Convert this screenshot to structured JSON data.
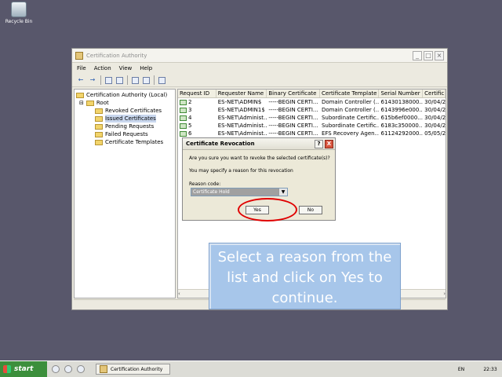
{
  "desktop": {
    "recycle_bin_label": "Recycle Bin"
  },
  "window": {
    "title": "Certification Authority",
    "menu": [
      "File",
      "Action",
      "View",
      "Help"
    ]
  },
  "tree": {
    "root_label": "Certification Authority (Local)",
    "child_label": "Root",
    "items": [
      "Revoked Certificates",
      "Issued Certificates",
      "Pending Requests",
      "Failed Requests",
      "Certificate Templates"
    ]
  },
  "list": {
    "columns": [
      "Request ID",
      "Requester Name",
      "Binary Certificate",
      "Certificate Template",
      "Serial Number",
      "Certific"
    ],
    "rows": [
      [
        "2",
        "ES-NET\\ADMIN$",
        "-----BEGIN CERTI...",
        "Domain Controller (...",
        "61430138000...",
        "30/04/2"
      ],
      [
        "3",
        "ES-NET\\ADMIN1$",
        "-----BEGIN CERTI...",
        "Domain Controller (...",
        "6143996e000...",
        "30/04/2"
      ],
      [
        "4",
        "ES-NET\\Administ...",
        "-----BEGIN CERTI...",
        "Subordinate Certific...",
        "615b6ef0000...",
        "30/04/2"
      ],
      [
        "5",
        "ES-NET\\Administ...",
        "-----BEGIN CERTI...",
        "Subordinate Certific...",
        "6183c350000...",
        "30/04/2"
      ],
      [
        "6",
        "ES-NET\\Administ...",
        "-----BEGIN CERTI...",
        "EFS Recovery Agen...",
        "61124292000...",
        "05/05/2"
      ]
    ]
  },
  "dialog": {
    "title": "Certificate Revocation",
    "question": "Are you sure you want to revoke the selected certificate(s)?",
    "subtext": "You may specify a reason for this revocation",
    "reason_label": "Reason code:",
    "reason_value": "Certificate Hold",
    "yes_label": "Yes",
    "no_label": "No",
    "help_label": "?",
    "close_label": "X"
  },
  "tooltip": {
    "text": "Select a reason from the list and click on Yes to continue."
  },
  "taskbar": {
    "start_label": "start",
    "task_label": "Certification Authority",
    "lang": "EN",
    "clock": "22:33"
  },
  "icons": {
    "titlebar": "certification-authority-icon",
    "cert": "certificate-icon"
  }
}
